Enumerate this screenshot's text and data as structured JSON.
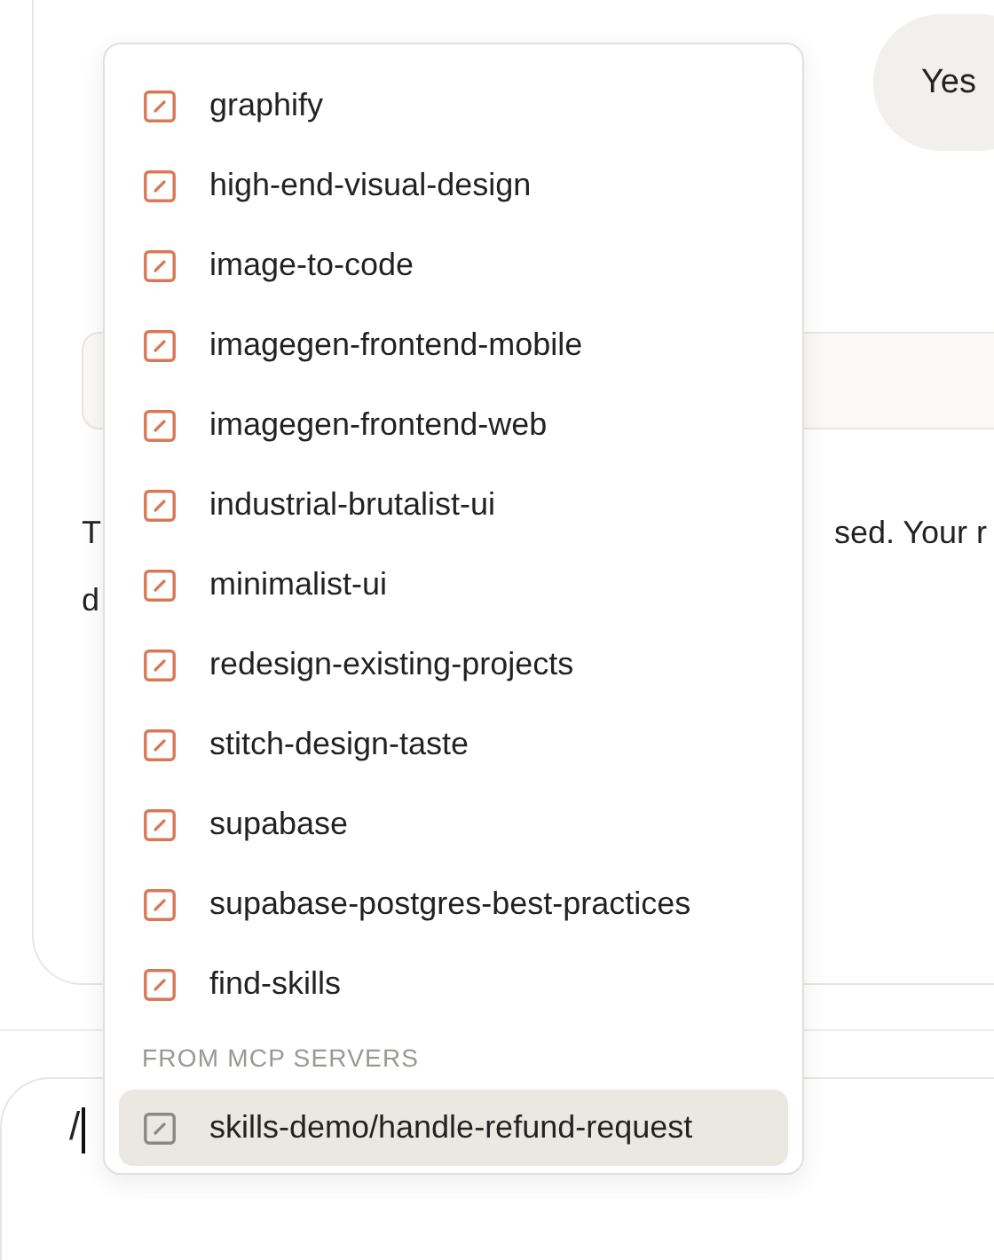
{
  "chat": {
    "user_bubble": {
      "text": "Yes"
    },
    "paragraph": {
      "line_1_left": "T",
      "line_1_right": "sed. Your r",
      "line_2_left": "d"
    }
  },
  "composer": {
    "value": "/"
  },
  "menu": {
    "items": [
      {
        "label": "graphify",
        "kind": "skill",
        "selected": false
      },
      {
        "label": "high-end-visual-design",
        "kind": "skill",
        "selected": false
      },
      {
        "label": "image-to-code",
        "kind": "skill",
        "selected": false
      },
      {
        "label": "imagegen-frontend-mobile",
        "kind": "skill",
        "selected": false
      },
      {
        "label": "imagegen-frontend-web",
        "kind": "skill",
        "selected": false
      },
      {
        "label": "industrial-brutalist-ui",
        "kind": "skill",
        "selected": false
      },
      {
        "label": "minimalist-ui",
        "kind": "skill",
        "selected": false
      },
      {
        "label": "redesign-existing-projects",
        "kind": "skill",
        "selected": false
      },
      {
        "label": "stitch-design-taste",
        "kind": "skill",
        "selected": false
      },
      {
        "label": "supabase",
        "kind": "skill",
        "selected": false
      },
      {
        "label": "supabase-postgres-best-practices",
        "kind": "skill",
        "selected": false
      },
      {
        "label": "find-skills",
        "kind": "skill",
        "selected": false
      }
    ],
    "section": {
      "heading": "FROM MCP SERVERS",
      "items": [
        {
          "label": "skills-demo/handle-refund-request",
          "kind": "mcp",
          "selected": true
        }
      ]
    }
  }
}
